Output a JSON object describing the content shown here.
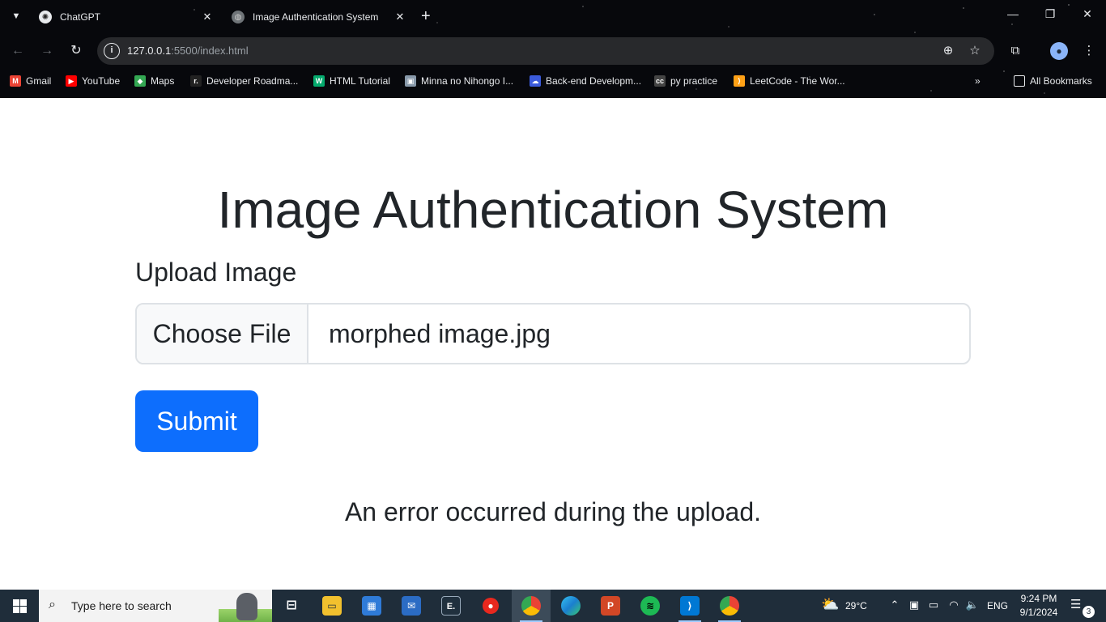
{
  "browser": {
    "tabs": [
      {
        "title": "ChatGPT",
        "icon": "chatgpt-icon",
        "active": false
      },
      {
        "title": "Image Authentication System",
        "icon": "globe-icon",
        "active": true
      }
    ],
    "url_host": "127.0.0.1",
    "url_rest": ":5500/index.html",
    "bookmarks": [
      {
        "label": "Gmail",
        "icon": "gmail-icon",
        "color": "#ea4335"
      },
      {
        "label": "YouTube",
        "icon": "youtube-icon",
        "color": "#ff0000"
      },
      {
        "label": "Maps",
        "icon": "maps-icon",
        "color": "#34a853"
      },
      {
        "label": "Developer Roadma...",
        "icon": "roadmap-icon",
        "color": "#222222"
      },
      {
        "label": "HTML Tutorial",
        "icon": "w3schools-icon",
        "color": "#04aa6d"
      },
      {
        "label": "Minna no Nihongo I...",
        "icon": "book-icon",
        "color": "#8899aa"
      },
      {
        "label": "Back-end Developm...",
        "icon": "cloud-icon",
        "color": "#3b5bdb"
      },
      {
        "label": "py practice",
        "icon": "cc-icon",
        "color": "#444444"
      },
      {
        "label": "LeetCode - The Wor...",
        "icon": "leetcode-icon",
        "color": "#ffa116"
      }
    ],
    "all_bookmarks": "All Bookmarks"
  },
  "page": {
    "title": "Image Authentication System",
    "upload_label": "Upload Image",
    "choose_file": "Choose File",
    "file_name": "morphed image.jpg",
    "submit": "Submit",
    "error": "An error occurred during the upload."
  },
  "taskbar": {
    "search_placeholder": "Type here to search",
    "weather": "29°C",
    "language": "ENG",
    "time": "9:24 PM",
    "date": "9/1/2024",
    "notification_count": "3"
  },
  "colors": {
    "primary_button": "#0d6efd",
    "text": "#212529",
    "taskbar": "#1f2d3a"
  }
}
